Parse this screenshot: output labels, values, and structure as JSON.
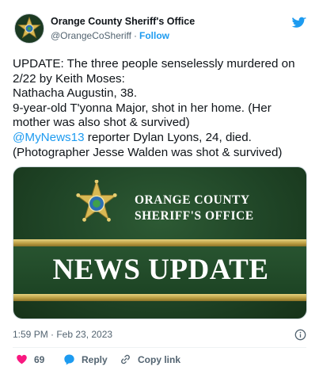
{
  "account": {
    "name": "Orange County Sheriff's Office",
    "handle": "@OrangeCoSheriff",
    "separator": "·",
    "follow_label": "Follow"
  },
  "tweet": {
    "lines": [
      "UPDATE: The three people senselessly murdered on",
      "2/22 by Keith Moses:",
      "Nathacha Augustin, 38.",
      "9-year-old T'yonna Major, shot in her home. (Her",
      "mother was also shot & survived)"
    ],
    "mention": "@MyNews13",
    "mention_rest": " reporter Dylan Lyons, 24, died.",
    "last_line": "(Photographer Jesse Walden was shot & survived)"
  },
  "media": {
    "org_line1": "ORANGE COUNTY",
    "org_line2": "SHERIFF'S OFFICE",
    "headline": "NEWS UPDATE"
  },
  "footer": {
    "timestamp": "1:59 PM · Feb 23, 2023",
    "like_count": "69",
    "reply_label": "Reply",
    "copy_link_label": "Copy link"
  },
  "colors": {
    "accent": "#1d9bf0",
    "like": "#f91880",
    "text": "#0f1419",
    "muted": "#536471",
    "media_green": "#1f4426",
    "media_gold": "#c9ab4e"
  },
  "icons": [
    "sheriff-star-icon",
    "twitter-bird-icon",
    "info-icon",
    "heart-icon",
    "reply-icon",
    "link-icon"
  ]
}
